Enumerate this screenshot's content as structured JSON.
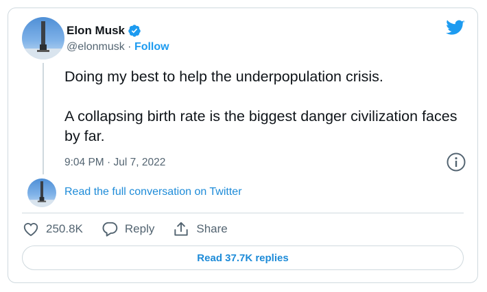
{
  "author": {
    "name": "Elon Musk",
    "handle": "@elonmusk",
    "separator": " · ",
    "follow_label": "Follow",
    "verified": true
  },
  "tweet": {
    "paragraphs": [
      "Doing my best to help the underpopulation crisis.",
      "A collapsing birth rate is the biggest danger civilization faces by far."
    ],
    "timestamp": "9:04 PM · Jul 7, 2022"
  },
  "conversation_link": "Read the full conversation on Twitter",
  "actions": {
    "likes": "250.8K",
    "reply_label": "Reply",
    "share_label": "Share"
  },
  "replies_button": "Read 37.7K replies",
  "colors": {
    "accent": "#1d9bf0",
    "text": "#0f1419",
    "muted": "#536471",
    "border": "#cfd9de"
  },
  "icons": [
    "twitter-bird-icon",
    "verified-badge-icon",
    "info-icon",
    "heart-icon",
    "reply-icon",
    "share-icon"
  ]
}
